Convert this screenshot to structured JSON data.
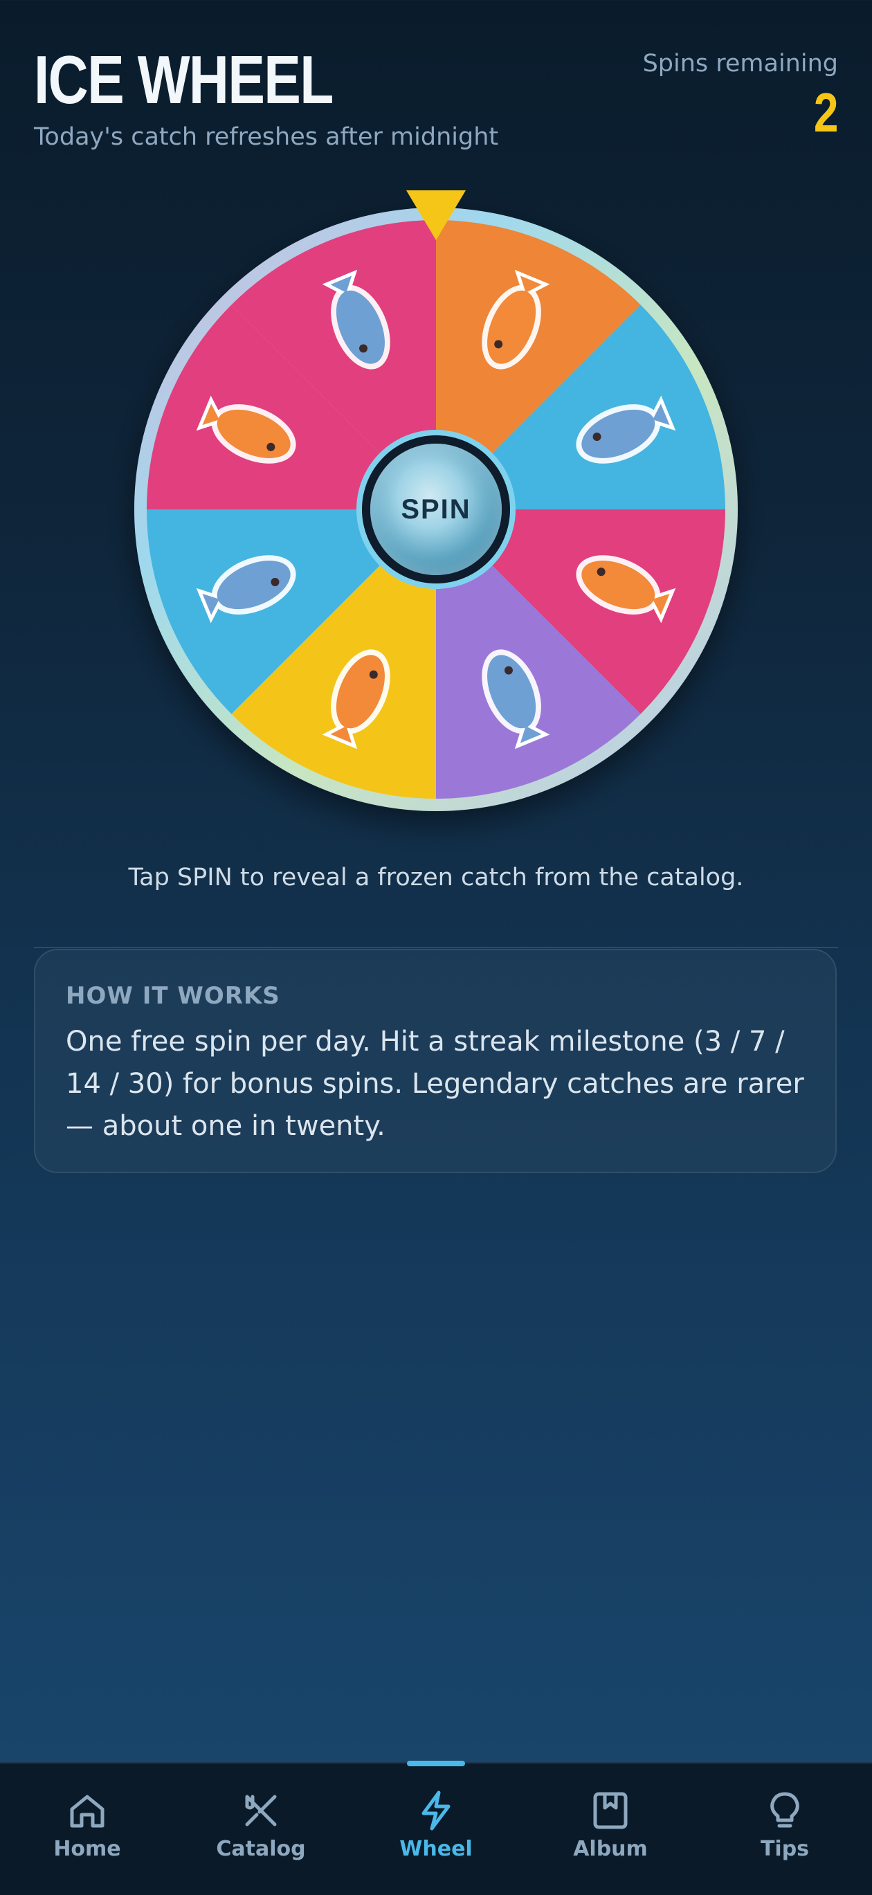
{
  "header": {
    "title": "ICE WHEEL",
    "subtitle": "Today's catch refreshes after midnight",
    "spins_label": "Spins remaining",
    "spins_count": "2"
  },
  "wheel": {
    "spin_label": "SPIN",
    "segments": [
      {
        "color": "#ee8537",
        "icon": "fish-popsicle-icon"
      },
      {
        "color": "#44b5e0",
        "icon": "blue-taiyaki-icon"
      },
      {
        "color": "#e23f7e",
        "icon": "fish-cookie-cup-icon"
      },
      {
        "color": "#9b78d8",
        "icon": "berry-popsicle-icon"
      },
      {
        "color": "#f4c518",
        "icon": "mermaid-tail-cone-icon"
      },
      {
        "color": "#44b5e0",
        "icon": "ice-cream-cone-icon"
      },
      {
        "color": "#e23f7e",
        "icon": "orange-fish-icon"
      },
      {
        "color": "#e23f7e",
        "icon": "swirl-sundae-icon"
      }
    ],
    "pointer_color": "#f5c518"
  },
  "hint": "Tap SPIN to reveal a frozen catch from the catalog.",
  "how_it_works": {
    "title": "HOW IT WORKS",
    "body": "One free spin per day. Hit a streak milestone (3 / 7 / 14 / 30) for bonus spins. Legendary catches are rarer — about one in twenty."
  },
  "nav": {
    "items": [
      {
        "label": "Home",
        "icon": "home-icon"
      },
      {
        "label": "Catalog",
        "icon": "catalog-icon"
      },
      {
        "label": "Wheel",
        "icon": "wheel-icon",
        "active": true
      },
      {
        "label": "Album",
        "icon": "album-icon"
      },
      {
        "label": "Tips",
        "icon": "tips-icon"
      }
    ],
    "accent": "#4ab8e8"
  }
}
